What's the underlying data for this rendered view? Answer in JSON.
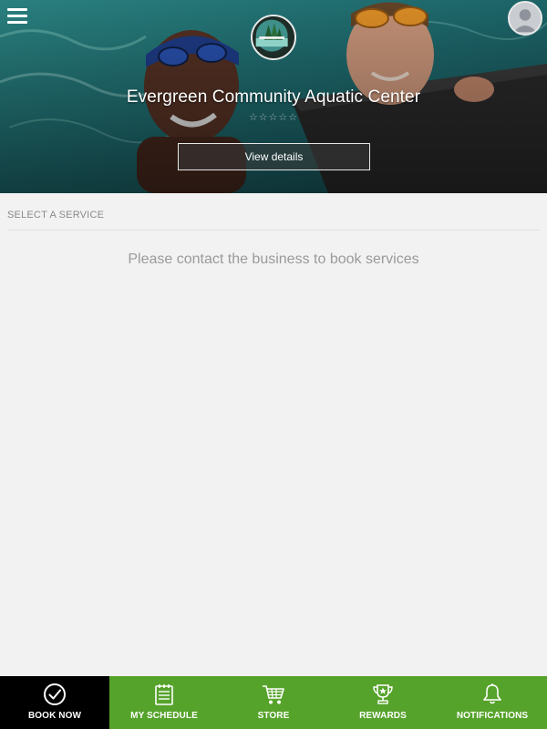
{
  "hero": {
    "business_name": "Evergreen Community Aquatic Center",
    "rating_stars": "☆☆☆☆☆",
    "view_details_label": "View details"
  },
  "services": {
    "section_label": "SELECT A SERVICE",
    "empty_message": "Please contact the business to book services"
  },
  "bottom_nav": {
    "items": [
      {
        "label": "BOOK NOW",
        "icon": "check-circle-icon",
        "active": true
      },
      {
        "label": "MY SCHEDULE",
        "icon": "calendar-icon",
        "active": false
      },
      {
        "label": "STORE",
        "icon": "cart-icon",
        "active": false
      },
      {
        "label": "REWARDS",
        "icon": "trophy-icon",
        "active": false
      },
      {
        "label": "NOTIFICATIONS",
        "icon": "bell-icon",
        "active": false
      }
    ]
  },
  "colors": {
    "nav_green": "#56a32b",
    "nav_active": "#000000",
    "page_background": "#f2f2f2"
  }
}
